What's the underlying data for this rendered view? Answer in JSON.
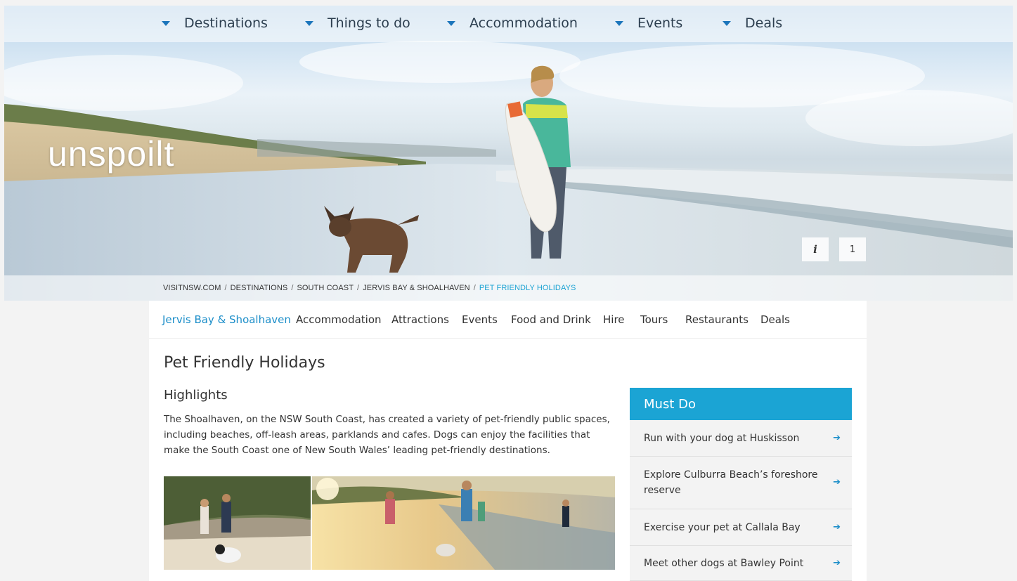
{
  "topnav": {
    "items": [
      {
        "label": "Destinations"
      },
      {
        "label": "Things to do"
      },
      {
        "label": "Accommodation"
      },
      {
        "label": "Events"
      },
      {
        "label": "Deals"
      }
    ]
  },
  "hero": {
    "title": "unspoilt",
    "info_label": "i",
    "slide_count": "1"
  },
  "breadcrumb": [
    {
      "label": "VISITNSW.COM"
    },
    {
      "label": "DESTINATIONS"
    },
    {
      "label": "SOUTH COAST"
    },
    {
      "label": "JERVIS BAY & SHOALHAVEN"
    },
    {
      "label": "PET FRIENDLY HOLIDAYS"
    }
  ],
  "subnav": {
    "tabs": [
      {
        "label": "Jervis Bay & Shoalhaven"
      },
      {
        "label": "Accommodation"
      },
      {
        "label": "Attractions"
      },
      {
        "label": "Events"
      },
      {
        "label": "Food and Drink"
      },
      {
        "label": "Hire"
      },
      {
        "label": "Tours"
      },
      {
        "label": "Restaurants"
      },
      {
        "label": "Deals"
      }
    ]
  },
  "main": {
    "title": "Pet Friendly Holidays",
    "section_title": "Highlights",
    "intro": "The Shoalhaven, on the NSW South Coast, has created a variety of pet-friendly public spaces, including beaches, off-leash areas, parklands and cafes. Dogs can enjoy the facilities that make the South Coast one of New South Wales’ leading pet-friendly destinations."
  },
  "mustdo": {
    "title": "Must Do",
    "items": [
      {
        "label": "Run with your dog at Huskisson"
      },
      {
        "label": "Explore Culburra Beach’s foreshore reserve"
      },
      {
        "label": "Exercise your pet at Callala Bay"
      },
      {
        "label": "Meet other dogs at Bawley Point"
      }
    ],
    "arrow_icon": "arrow-right-icon"
  },
  "colors": {
    "accent": "#1ba4d4",
    "link": "#1c8ec9",
    "nav_caret": "#1b75bb"
  }
}
